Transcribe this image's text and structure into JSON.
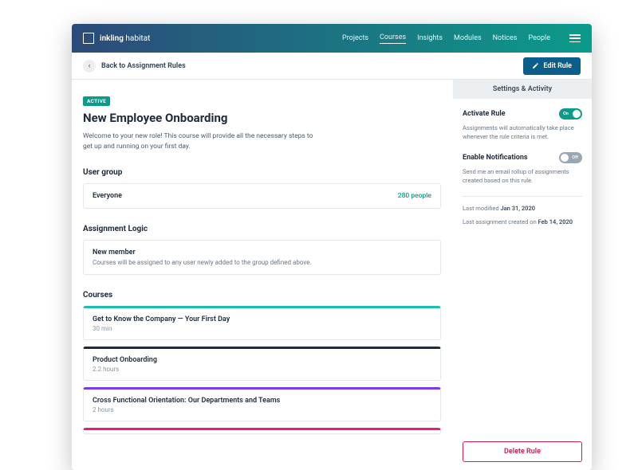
{
  "brand": {
    "first": "inkling",
    "second": "habitat"
  },
  "nav": [
    "Projects",
    "Courses",
    "Insights",
    "Modules",
    "Notices",
    "People"
  ],
  "subbar": {
    "back": "Back to Assignment Rules",
    "edit": "Edit Rule"
  },
  "status": "ACTIVE",
  "title": "New Employee Onboarding",
  "description": "Welcome to your new role! This course will provide all the necessary steps to get up and running on your first day.",
  "sections": {
    "usergroup": "User group",
    "logic": "Assignment Logic",
    "courses": "Courses"
  },
  "usergroup": {
    "name": "Everyone",
    "count": "280 people"
  },
  "logic": {
    "title": "New member",
    "desc": "Courses will be assigned to any user newly added to the group defined above."
  },
  "courses": [
    {
      "name": "Get to Know the Company — Your First Day",
      "duration": "30 min"
    },
    {
      "name": "Product Onboarding",
      "duration": "2.2 hours"
    },
    {
      "name": "Cross Functional Orientation: Our Departments and Teams",
      "duration": "2 hours"
    }
  ],
  "sidebar": {
    "header": "Settings & Activity",
    "activate": {
      "label": "Activate Rule",
      "state": "On",
      "desc": "Assignments will automatically take place whenever the rule criteria is met."
    },
    "notify": {
      "label": "Enable Notifications",
      "state": "Off",
      "desc": "Send me an email rollup of assignments created based on this rule."
    },
    "modified_prefix": "Last modified ",
    "modified_date": "Jan 31, 2020",
    "assigned_prefix": "Last assignment created on ",
    "assigned_date": "Feb 14, 2020",
    "delete": "Delete Rule"
  }
}
